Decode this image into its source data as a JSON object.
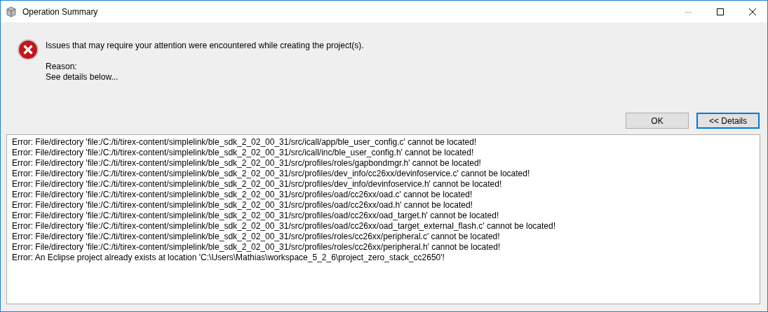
{
  "window": {
    "title": "Operation Summary"
  },
  "message": {
    "text": "Issues that may require your attention were encountered while creating the project(s).",
    "reason_label": "Reason:",
    "reason": "See details below..."
  },
  "buttons": [
    {
      "label": "OK",
      "focused": false
    },
    {
      "label": "<< Details",
      "focused": true
    }
  ],
  "details": [
    "Error: File/directory 'file:/C:/ti/tirex-content/simplelink/ble_sdk_2_02_00_31/src/icall/app/ble_user_config.c' cannot be located!",
    "Error: File/directory 'file:/C:/ti/tirex-content/simplelink/ble_sdk_2_02_00_31/src/icall/inc/ble_user_config.h' cannot be located!",
    "Error: File/directory 'file:/C:/ti/tirex-content/simplelink/ble_sdk_2_02_00_31/src/profiles/roles/gapbondmgr.h' cannot be located!",
    "Error: File/directory 'file:/C:/ti/tirex-content/simplelink/ble_sdk_2_02_00_31/src/profiles/dev_info/cc26xx/devinfoservice.c' cannot be located!",
    "Error: File/directory 'file:/C:/ti/tirex-content/simplelink/ble_sdk_2_02_00_31/src/profiles/dev_info/devinfoservice.h' cannot be located!",
    "Error: File/directory 'file:/C:/ti/tirex-content/simplelink/ble_sdk_2_02_00_31/src/profiles/oad/cc26xx/oad.c' cannot be located!",
    "Error: File/directory 'file:/C:/ti/tirex-content/simplelink/ble_sdk_2_02_00_31/src/profiles/oad/cc26xx/oad.h' cannot be located!",
    "Error: File/directory 'file:/C:/ti/tirex-content/simplelink/ble_sdk_2_02_00_31/src/profiles/oad/cc26xx/oad_target.h' cannot be located!",
    "Error: File/directory 'file:/C:/ti/tirex-content/simplelink/ble_sdk_2_02_00_31/src/profiles/oad/cc26xx/oad_target_external_flash.c' cannot be located!",
    "Error: File/directory 'file:/C:/ti/tirex-content/simplelink/ble_sdk_2_02_00_31/src/profiles/roles/cc26xx/peripheral.c' cannot be located!",
    "Error: File/directory 'file:/C:/ti/tirex-content/simplelink/ble_sdk_2_02_00_31/src/profiles/roles/cc26xx/peripheral.h' cannot be located!",
    "Error: An Eclipse project already exists at location 'C:\\Users\\Mathias\\workspace_5_2_6\\project_zero_stack_cc2650'!"
  ]
}
